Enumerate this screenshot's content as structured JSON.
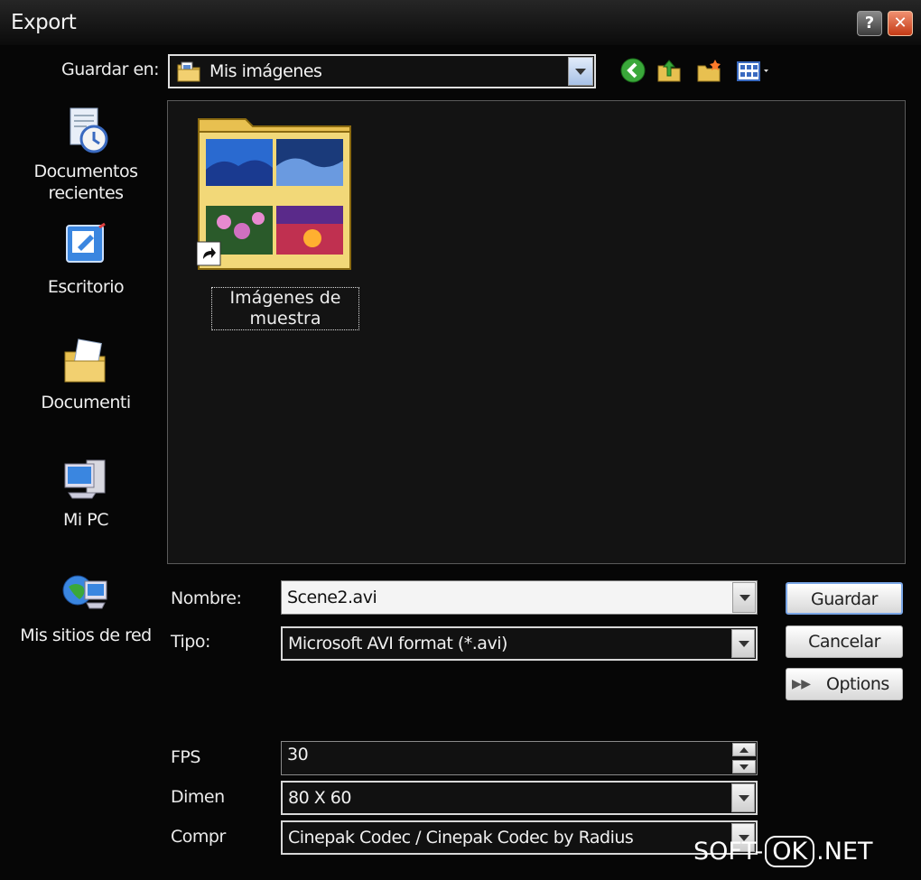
{
  "window": {
    "title": "Export"
  },
  "toolbar": {
    "save_in_label": "Guardar en:",
    "save_in_value": "Mis imágenes"
  },
  "places": [
    {
      "label": "Documentos recientes"
    },
    {
      "label": "Escritorio"
    },
    {
      "label": "Documenti"
    },
    {
      "label": "Mi PC"
    },
    {
      "label": "Mis sitios de red"
    }
  ],
  "files": [
    {
      "label": "Imágenes de muestra"
    }
  ],
  "form": {
    "name_label": "Nombre:",
    "name_value": "Scene2.avi",
    "type_label": "Tipo:",
    "type_value": "Microsoft AVI format (*.avi)",
    "fps_label": "FPS",
    "fps_value": "30",
    "dimen_label": "Dimen",
    "dimen_value": "80 X 60",
    "compr_label": "Compr",
    "compr_value": "Cinepak Codec / Cinepak Codec by Radius"
  },
  "buttons": {
    "save": "Guardar",
    "cancel": "Cancelar",
    "options": "Options"
  },
  "watermark": {
    "pre": "SOFT-",
    "ok": "OK",
    "post": ".NET"
  },
  "icons": [
    "folder-icon",
    "back-icon",
    "up-folder-icon",
    "new-folder-icon",
    "view-menu-icon",
    "help-icon",
    "close-icon",
    "recent-documents-icon",
    "desktop-icon",
    "documents-icon",
    "my-computer-icon",
    "network-places-icon",
    "shortcut-arrow-icon",
    "chevron-down-icon"
  ]
}
